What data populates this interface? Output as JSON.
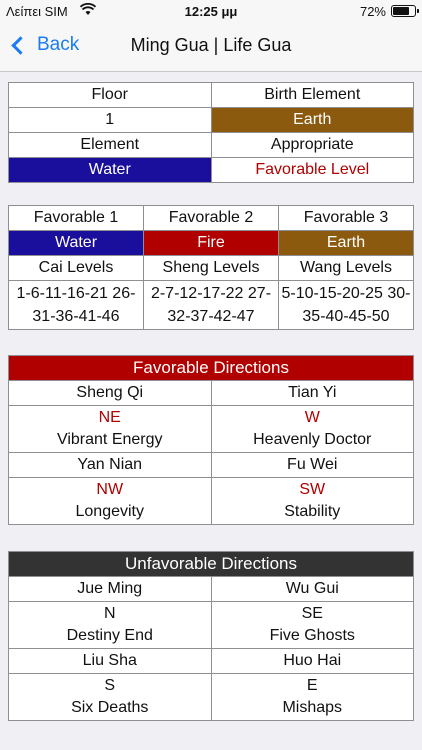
{
  "status": {
    "carrier": "Λείπει SIM",
    "time": "12:25 μμ",
    "battery": "72%"
  },
  "nav": {
    "back_label": "Back",
    "title": "Ming Gua | Life Gua"
  },
  "info": {
    "floor_header": "Floor",
    "birth_element_header": "Birth Element",
    "floor_value": "1",
    "birth_element_value": "Earth",
    "element_header": "Element",
    "appropriate_header": "Appropriate",
    "element_value": "Water",
    "appropriate_value": "Favorable Level"
  },
  "favorable": [
    {
      "header": "Favorable 1",
      "element": "Water",
      "level": "Cai Levels",
      "numbers": "1-6-11-16-21 26-31-36-41-46"
    },
    {
      "header": "Favorable 2",
      "element": "Fire",
      "level": "Sheng Levels",
      "numbers": "2-7-12-17-22 27-32-37-42-47"
    },
    {
      "header": "Favorable 3",
      "element": "Earth",
      "level": "Wang Levels",
      "numbers": "5-10-15-20-25 30-35-40-45-50"
    }
  ],
  "favorable_directions": {
    "title": "Favorable Directions",
    "items": [
      {
        "name": "Sheng Qi",
        "dir": "NE",
        "desc": "Vibrant Energy"
      },
      {
        "name": "Tian Yi",
        "dir": "W",
        "desc": "Heavenly Doctor"
      },
      {
        "name": "Yan Nian",
        "dir": "NW",
        "desc": "Longevity"
      },
      {
        "name": "Fu Wei",
        "dir": "SW",
        "desc": "Stability"
      }
    ]
  },
  "unfavorable_directions": {
    "title": "Unfavorable Directions",
    "items": [
      {
        "name": "Jue Ming",
        "dir": "N",
        "desc": "Destiny End"
      },
      {
        "name": "Wu Gui",
        "dir": "SE",
        "desc": "Five Ghosts"
      },
      {
        "name": "Liu Sha",
        "dir": "S",
        "desc": "Six Deaths"
      },
      {
        "name": "Huo Hai",
        "dir": "E",
        "desc": "Mishaps"
      }
    ]
  },
  "colors": {
    "water": "#1a0f9c",
    "fire": "#b00000",
    "earth": "#8b5a0f",
    "link": "#1a7cf5",
    "dark_header": "#333333"
  }
}
